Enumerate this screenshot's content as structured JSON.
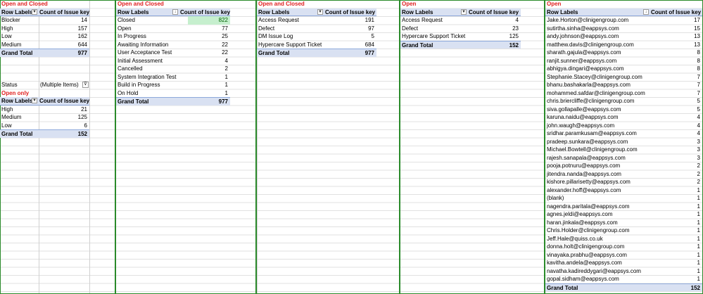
{
  "pivots": {
    "p1": {
      "title": "Open and Closed",
      "header_row": "Row Labels",
      "header_value": "Count of Issue key",
      "rows": [
        {
          "label": "Blocker",
          "value": "14"
        },
        {
          "label": "High",
          "value": "157"
        },
        {
          "label": "Low",
          "value": "162"
        },
        {
          "label": "Medium",
          "value": "644"
        }
      ],
      "total_label": "Grand Total",
      "total_value": "977"
    },
    "p1b": {
      "filter_label": "Status",
      "filter_value": "(Multiple Items)",
      "title": "Open only",
      "header_row": "Row Labels",
      "header_value": "Count of Issue key",
      "rows": [
        {
          "label": "High",
          "value": "21"
        },
        {
          "label": "Medium",
          "value": "125"
        },
        {
          "label": "Low",
          "value": "6"
        }
      ],
      "total_label": "Grand Total",
      "total_value": "152"
    },
    "p2": {
      "title": "Open and Closed",
      "header_row": "Row Labels",
      "header_value": "Count of Issue key",
      "rows": [
        {
          "label": "Closed",
          "value": "822"
        },
        {
          "label": "Open",
          "value": "77"
        },
        {
          "label": "In Progress",
          "value": "25"
        },
        {
          "label": "Awaiting Information",
          "value": "22"
        },
        {
          "label": "User Acceptance Test",
          "value": "22"
        },
        {
          "label": "Initial Assessment",
          "value": "4"
        },
        {
          "label": "Cancelled",
          "value": "2"
        },
        {
          "label": "System Integration Test",
          "value": "1"
        },
        {
          "label": "Build in Progress",
          "value": "1"
        },
        {
          "label": "On Hold",
          "value": "1"
        }
      ],
      "total_label": "Grand Total",
      "total_value": "977"
    },
    "p3": {
      "title": "Open and Closed",
      "header_row": "Row Labels",
      "header_value": "Count of Issue key",
      "rows": [
        {
          "label": "Access Request",
          "value": "191"
        },
        {
          "label": "Defect",
          "value": "97"
        },
        {
          "label": "DM Issue Log",
          "value": "5"
        },
        {
          "label": "Hypercare Support Ticket",
          "value": "684"
        }
      ],
      "total_label": "Grand Total",
      "total_value": "977"
    },
    "p4": {
      "title": "Open",
      "header_row": "Row Labels",
      "header_value": "Count of Issue key",
      "rows": [
        {
          "label": "Access Request",
          "value": "4"
        },
        {
          "label": "Defect",
          "value": "23"
        },
        {
          "label": "Hypercare Support Ticket",
          "value": "125"
        }
      ],
      "total_label": "Grand Total",
      "total_value": "152"
    },
    "p5": {
      "title": "Open",
      "header_row": "Row Labels",
      "header_value": "Count of Issue key",
      "rows": [
        {
          "label": "Jake.Horton@clinigengroup.com",
          "value": "17"
        },
        {
          "label": "sutirtha.sinha@eappsys.com",
          "value": "15"
        },
        {
          "label": "andy.johnson@eappsys.com",
          "value": "13"
        },
        {
          "label": "matthew.davis@clinigengroup.com",
          "value": "13"
        },
        {
          "label": "sharath.gajula@eappsys.com",
          "value": "8"
        },
        {
          "label": "ranjit.sunner@eappsys.com",
          "value": "8"
        },
        {
          "label": "abhigya.dingari@eappsys.com",
          "value": "8"
        },
        {
          "label": "Stephanie.Stacey@clinigengroup.com",
          "value": "7"
        },
        {
          "label": "bhanu.bashakarla@eappsys.com",
          "value": "7"
        },
        {
          "label": "mohammed.safdar@clinigengroup.com",
          "value": "7"
        },
        {
          "label": "chris.briercliffe@clinigengroup.com",
          "value": "5"
        },
        {
          "label": "siva.gollapalle@eappsys.com",
          "value": "5"
        },
        {
          "label": "karuna.naidu@eappsys.com",
          "value": "4"
        },
        {
          "label": "john.waugh@eappsys.com",
          "value": "4"
        },
        {
          "label": "sridhar.paramkusam@eappsys.com",
          "value": "4"
        },
        {
          "label": "pradeep.sunkara@eappsys.com",
          "value": "3"
        },
        {
          "label": "Michael.Bowtell@clinigengroup.com",
          "value": "3"
        },
        {
          "label": "rajesh.sanapala@eappsys.com",
          "value": "3"
        },
        {
          "label": "pooja.potnuru@eappsys.com",
          "value": "2"
        },
        {
          "label": "jitendra.nanda@eappsys.com",
          "value": "2"
        },
        {
          "label": "kishore.pillarisetty@eappsys.com",
          "value": "2"
        },
        {
          "label": "alexander.hoff@eappsys.com",
          "value": "1"
        },
        {
          "label": "(blank)",
          "value": "1"
        },
        {
          "label": "nagendra.paritala@eappsys.com",
          "value": "1"
        },
        {
          "label": "agnes.jeldi@eappsys.com",
          "value": "1"
        },
        {
          "label": "haran.jinkala@eappsys.com",
          "value": "1"
        },
        {
          "label": "Chris.Holder@clinigengroup.com",
          "value": "1"
        },
        {
          "label": "Jeff.Hale@quiss.co.uk",
          "value": "1"
        },
        {
          "label": "donna.holt@clinigengroup.com",
          "value": "1"
        },
        {
          "label": "vinayaka.prabhu@eappsys.com",
          "value": "1"
        },
        {
          "label": "kavitha.andela@eappsys.com",
          "value": "1"
        },
        {
          "label": "navatha.kadireddygari@eappsys.com",
          "value": "1"
        },
        {
          "label": "gopal.sidham@eappsys.com",
          "value": "1"
        }
      ],
      "total_label": "Grand Total",
      "total_value": "152"
    }
  },
  "icons": {
    "filter_dropdown": "chevron-down-icon",
    "sort_dropdown": "sort-descending-icon",
    "filter_active": "funnel-icon"
  },
  "colors": {
    "title_red": "#e02020",
    "header_fill": "#d9e1f2",
    "highlight_fill": "#c6efce",
    "frame_green": "#2a8a2a"
  }
}
